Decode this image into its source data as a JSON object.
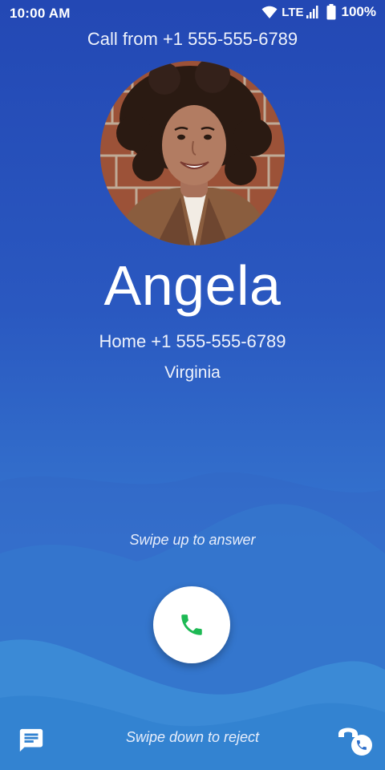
{
  "status_bar": {
    "time": "10:00 AM",
    "network": "LTE",
    "battery": "100%"
  },
  "call": {
    "header": "Call from +1 555-555-6789",
    "caller_name": "Angela",
    "caller_number": "Home +1 555-555-6789",
    "caller_location": "Virginia"
  },
  "actions": {
    "answer_hint": "Swipe up to answer",
    "reject_hint": "Swipe down to reject"
  },
  "icons": {
    "wifi": "wifi-icon",
    "signal": "cell-signal-icon",
    "battery": "battery-icon",
    "answer": "phone-icon",
    "message": "message-icon",
    "rtt": "rtt-call-icon"
  },
  "colors": {
    "background_top": "#2348b4",
    "background_bottom": "#3a86d8",
    "answer_icon": "#1db954"
  }
}
